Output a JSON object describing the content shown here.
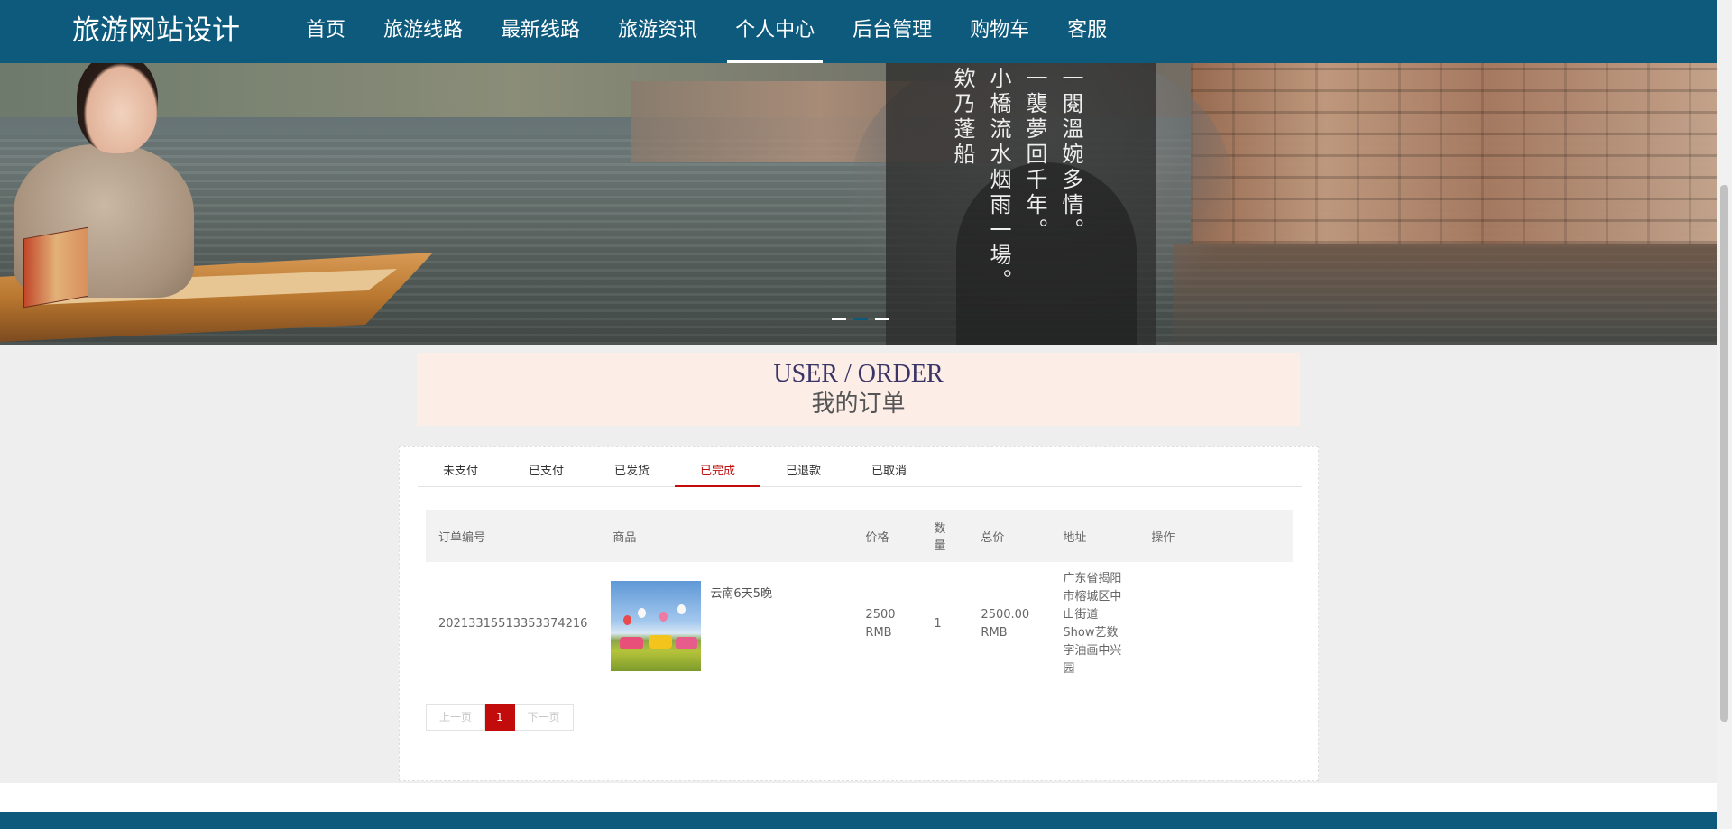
{
  "brand": "旅游网站设计",
  "nav": [
    {
      "label": "首页"
    },
    {
      "label": "旅游线路"
    },
    {
      "label": "最新线路"
    },
    {
      "label": "旅游资讯"
    },
    {
      "label": "个人中心",
      "active": true
    },
    {
      "label": "后台管理"
    },
    {
      "label": "购物车"
    },
    {
      "label": "客服"
    }
  ],
  "banner": {
    "poem_cols": [
      "一閱溫婉多情。",
      "一襲夢回千年。",
      "小橋流水烟雨一場。",
      "欸乃蓬船"
    ],
    "slide_count": 3,
    "active_slide": 2
  },
  "title": {
    "en": "USER / ORDER",
    "cn": "我的订单"
  },
  "tabs": [
    {
      "label": "未支付"
    },
    {
      "label": "已支付"
    },
    {
      "label": "已发货"
    },
    {
      "label": "已完成",
      "active": true
    },
    {
      "label": "已退款"
    },
    {
      "label": "已取消"
    }
  ],
  "table": {
    "headers": {
      "order_no": "订单编号",
      "product": "商品",
      "price": "价格",
      "qty": "数量",
      "total": "总价",
      "address": "地址",
      "action": "操作"
    },
    "rows": [
      {
        "order_no": "20213315513353374216",
        "product": "云南6天5晚",
        "price": "2500 RMB",
        "qty": "1",
        "total": "2500.00 RMB",
        "address": "广东省揭阳市榕城区中山街道Show艺数字油画中兴园",
        "action": ""
      }
    ]
  },
  "pager": {
    "prev": "上一页",
    "current": "1",
    "next": "下一页"
  },
  "colors": {
    "nav_bg": "#0d5a7d",
    "accent_red": "#c20b0b",
    "title_bg": "#fcede7"
  }
}
